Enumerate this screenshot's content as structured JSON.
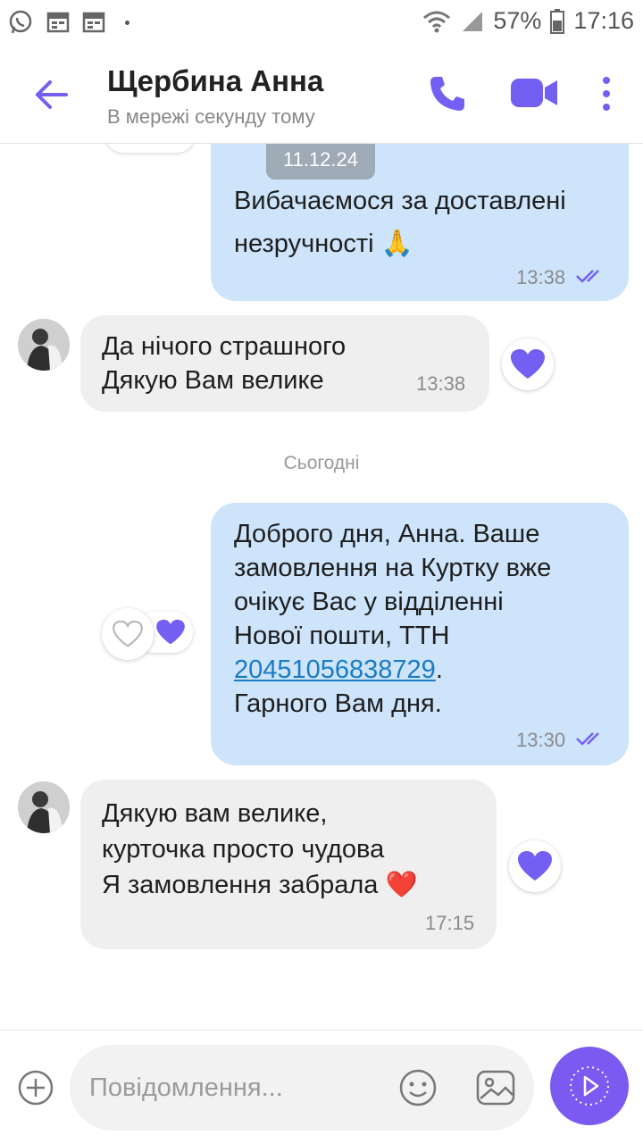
{
  "status_bar": {
    "battery": "57%",
    "time": "17:16",
    "icons": [
      "whatsapp-icon",
      "calendar-icon",
      "calendar-icon",
      "wifi-icon",
      "signal-icon",
      "battery-icon"
    ]
  },
  "header": {
    "contact_name": "Щербина Анна",
    "presence": "В мережі секунду тому"
  },
  "chat": {
    "date_chip": "11.12.24",
    "messages": [
      {
        "direction": "out",
        "text": "Вибачаємося за доставлені\nнезручності 🙏",
        "time": "13:38",
        "status": "read"
      },
      {
        "direction": "in",
        "text": "Да нічого страшного\nДякую Вам велике",
        "time": "13:38",
        "reaction": "heart"
      },
      {
        "direction": "out",
        "text_before_link": "Доброго дня, Анна. Ваше\nзамовлення на Куртку вже\nочікує Вас у відділенні\nНової пошти, ТТН\n",
        "link": "20451056838729",
        "text_after_link": ".\nГарного Вам дня.",
        "time": "13:30",
        "status": "read",
        "reaction": "heart"
      },
      {
        "direction": "in",
        "text": "Дякую вам велике,\nкурточка просто чудова\nЯ замовлення забрала ❤️",
        "time": "17:15",
        "reaction": "heart"
      }
    ],
    "day_separator": "Сьогодні"
  },
  "composer": {
    "placeholder": "Повідомлення..."
  },
  "colors": {
    "accent": "#7360f2",
    "outgoing_bubble": "#cde4fb",
    "incoming_bubble": "#efefef",
    "link": "#1a7cc4"
  }
}
